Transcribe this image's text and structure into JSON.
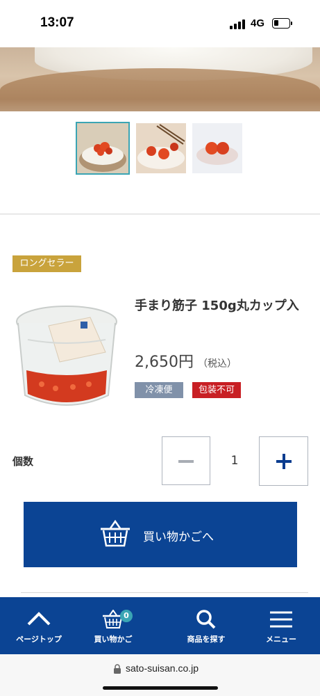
{
  "status_bar": {
    "time": "13:07",
    "network": "4G"
  },
  "product": {
    "badge": "ロングセラー",
    "name": "手まり筋子 150g丸カップ入",
    "price": "2,650円",
    "tax_note": "（税込）",
    "tags": {
      "frozen": "冷凍便",
      "no_wrap": "包装不可"
    }
  },
  "quantity": {
    "label": "個数",
    "value": "1"
  },
  "cart_button": {
    "label": "買い物かごへ"
  },
  "bottom_nav": {
    "page_top": "ページトップ",
    "cart": "買い物かご",
    "cart_count": "0",
    "search": "商品を探す",
    "menu": "メニュー"
  },
  "url_bar": {
    "url": "sato-suisan.co.jp"
  },
  "colors": {
    "brand_blue": "#0b4494",
    "badge_gold": "#c9a33c",
    "tag_gray_blue": "#8091a9",
    "tag_red": "#c81f24",
    "accent_teal": "#3aa5b4"
  }
}
